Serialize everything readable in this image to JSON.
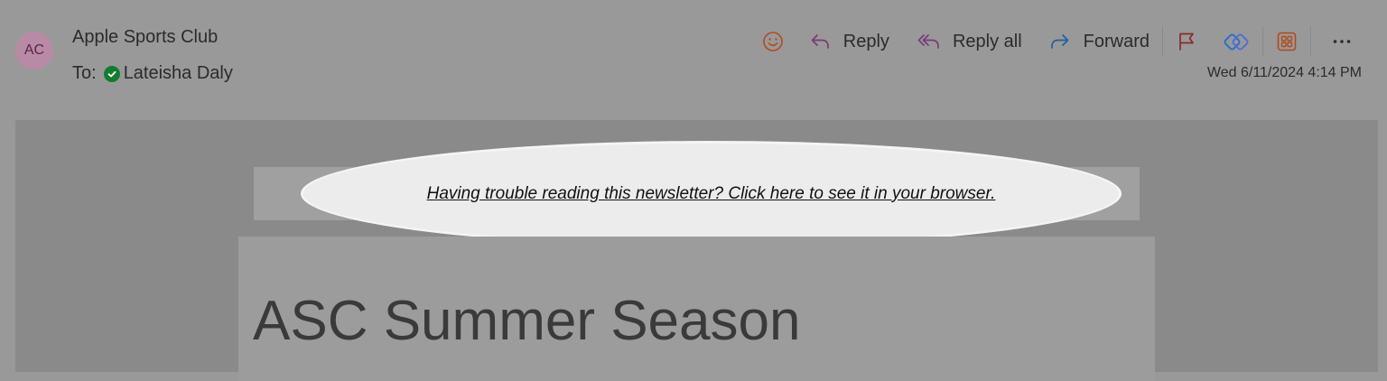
{
  "message": {
    "avatar_initials": "AC",
    "sender": "Apple Sports Club",
    "to_label": "To:",
    "recipient": "Lateisha Daly",
    "date": "Wed 6/11/2024 4:14 PM"
  },
  "toolbar": {
    "emoji_icon": "smiley-icon",
    "reply": "Reply",
    "reply_all": "Reply all",
    "forward": "Forward",
    "flag_icon": "flag-icon",
    "loop_icon": "loop-icon",
    "apps_icon": "apps-icon",
    "more_icon": "more-icon"
  },
  "email_body": {
    "browser_link": "Having trouble reading this newsletter? Click here to see it in your browser.",
    "headline": "ASC Summer Season"
  },
  "colors": {
    "background": "#999999",
    "body_background": "#8a8a8a",
    "reply_accent": "#7a3a78",
    "forward_accent": "#1f5fa8",
    "emoji_accent": "#b24a1e",
    "flag_accent": "#8b2a2a",
    "presence": "#137c2d"
  }
}
